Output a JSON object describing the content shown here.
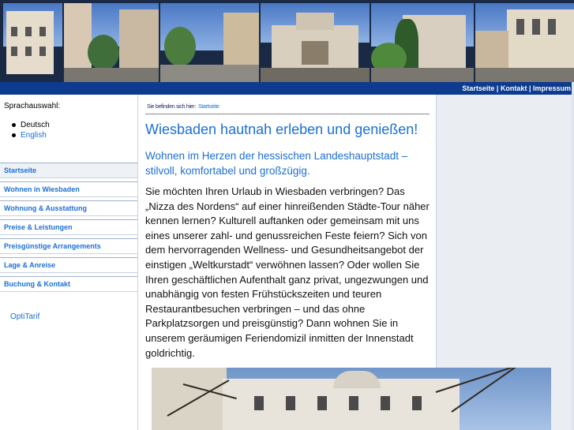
{
  "header": {
    "links": [
      "Startseite",
      "Kontakt",
      "Impressum"
    ],
    "separator": " | "
  },
  "sidebar": {
    "language_title": "Sprachauswahl:",
    "languages": [
      "Deutsch",
      "English"
    ],
    "menu": [
      "Startseite",
      "Wohnen in Wiesbaden",
      "Wohnung & Ausstattung",
      "Preise & Leistungen",
      "Preisgünstige Arrangements",
      "Lage & Anreise",
      "Buchung & Kontakt"
    ],
    "extra_link": "OptiTarif"
  },
  "main": {
    "breadcrumb_label": "Sie befinden sich hier:",
    "breadcrumb_current": "Startseite",
    "headline": "Wiesbaden hautnah erleben und genießen!",
    "subheadline": "Wohnen im Herzen der hessischen Landeshauptstadt – stilvoll, komfortabel und großzügig.",
    "body": "Sie möchten Ihren Urlaub in Wiesbaden verbringen? Das „Nizza des Nordens“ auf einer hinreißenden Städte-Tour näher kennen lernen? Kulturell auftanken oder gemeinsam mit uns eines unserer zahl- und genussreichen Feste feiern? Sich von dem hervorragenden Wellness- und Gesundheitsangebot der einstigen „Weltkurstadt“ verwöhnen lassen? Oder wollen Sie Ihren geschäftlichen Aufenthalt ganz privat, ungezwungen und unabhängig von festen Frühstückszeiten und teuren Restaurantbesuchen verbringen – und das ohne Parkplatzsorgen und preisgünstig? Dann wohnen Sie in unserem geräumigen Feriendomizil inmitten der Innenstadt goldrichtig."
  },
  "colors": {
    "nav_bar": "#0c3b8f",
    "link": "#1b6fd6",
    "right_column": "#eaedf2"
  }
}
